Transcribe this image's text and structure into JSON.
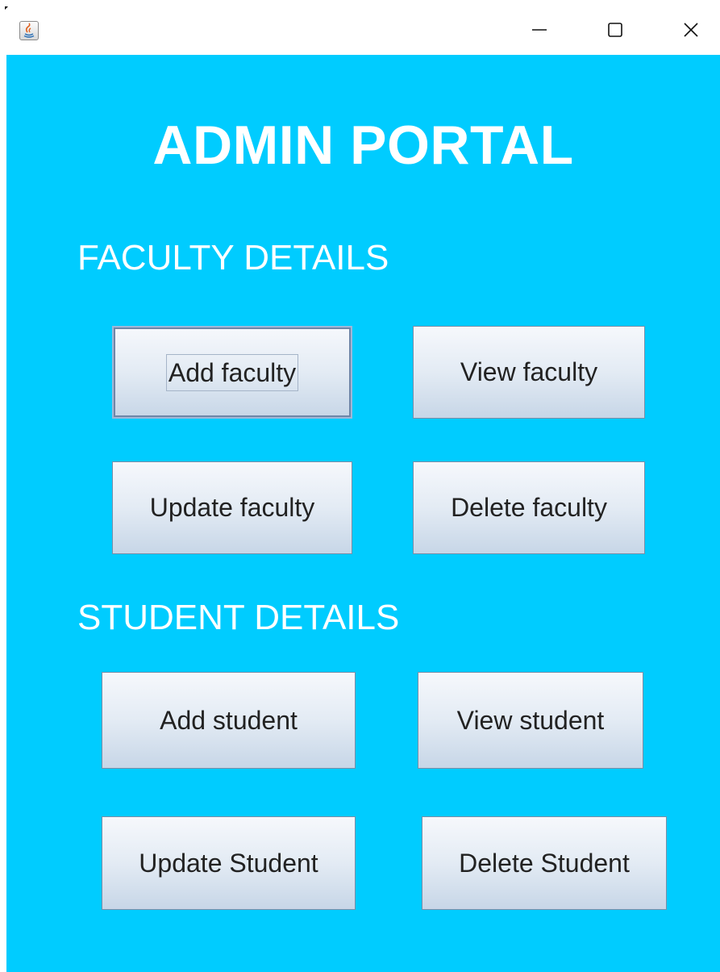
{
  "window": {
    "app_icon": "java-icon",
    "controls": {
      "minimize_icon": "minimize-icon",
      "maximize_icon": "maximize-icon",
      "close_icon": "close-icon"
    }
  },
  "colors": {
    "background": "#00ccff",
    "heading_text": "#ffffff",
    "button_text": "#222222"
  },
  "portal": {
    "title": "ADMIN PORTAL",
    "faculty": {
      "heading": "FACULTY DETAILS",
      "add_label": "Add faculty",
      "view_label": "View faculty",
      "update_label": "Update faculty",
      "delete_label": "Delete faculty"
    },
    "student": {
      "heading": "STUDENT DETAILS",
      "add_label": "Add student",
      "view_label": "View student",
      "update_label": "Update Student",
      "delete_label": "Delete Student"
    }
  }
}
